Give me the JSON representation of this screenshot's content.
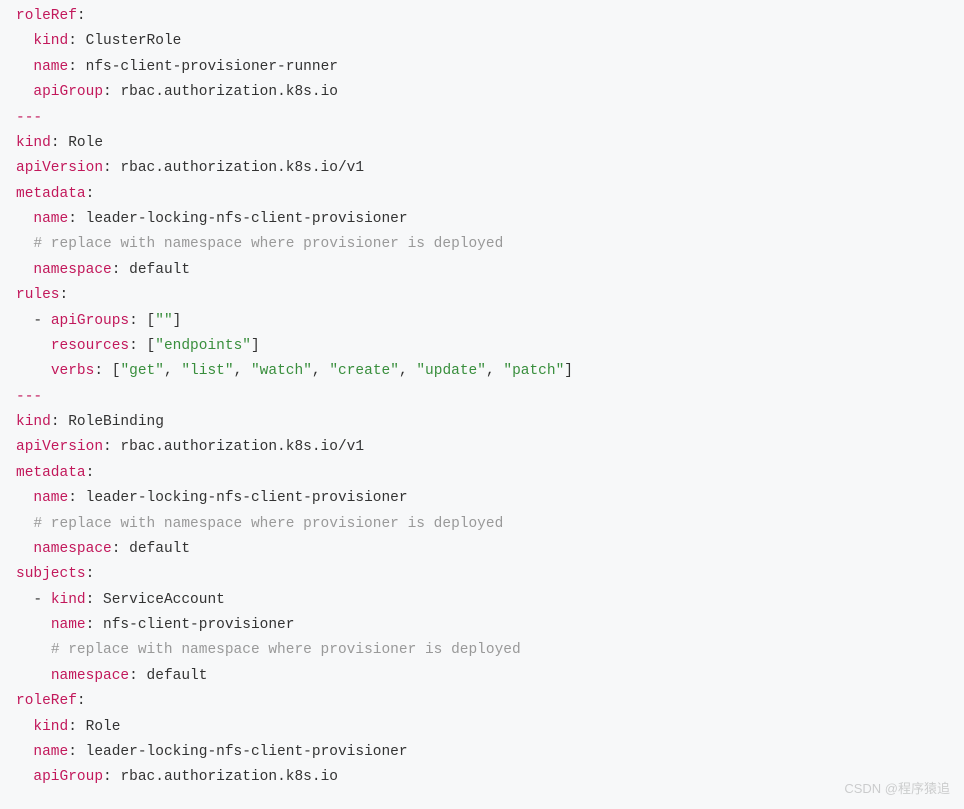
{
  "lines": [
    {
      "i": 0,
      "t": [
        {
          "c": "key",
          "v": "roleRef"
        },
        {
          "c": "punct",
          "v": ":"
        }
      ]
    },
    {
      "i": 2,
      "t": [
        {
          "c": "key",
          "v": "kind"
        },
        {
          "c": "punct",
          "v": ": "
        },
        {
          "c": "value",
          "v": "ClusterRole"
        }
      ]
    },
    {
      "i": 2,
      "t": [
        {
          "c": "key",
          "v": "name"
        },
        {
          "c": "punct",
          "v": ": "
        },
        {
          "c": "value",
          "v": "nfs-client-provisioner-runner"
        }
      ]
    },
    {
      "i": 2,
      "t": [
        {
          "c": "key",
          "v": "apiGroup"
        },
        {
          "c": "punct",
          "v": ": "
        },
        {
          "c": "value",
          "v": "rbac.authorization.k8s.io"
        }
      ]
    },
    {
      "i": 0,
      "t": [
        {
          "c": "key",
          "v": "---"
        }
      ]
    },
    {
      "i": 0,
      "t": [
        {
          "c": "key",
          "v": "kind"
        },
        {
          "c": "punct",
          "v": ": "
        },
        {
          "c": "value",
          "v": "Role"
        }
      ]
    },
    {
      "i": 0,
      "t": [
        {
          "c": "key",
          "v": "apiVersion"
        },
        {
          "c": "punct",
          "v": ": "
        },
        {
          "c": "value",
          "v": "rbac.authorization.k8s.io/v1"
        }
      ]
    },
    {
      "i": 0,
      "t": [
        {
          "c": "key",
          "v": "metadata"
        },
        {
          "c": "punct",
          "v": ":"
        }
      ]
    },
    {
      "i": 2,
      "t": [
        {
          "c": "key",
          "v": "name"
        },
        {
          "c": "punct",
          "v": ": "
        },
        {
          "c": "value",
          "v": "leader-locking-nfs-client-provisioner"
        }
      ]
    },
    {
      "i": 2,
      "t": [
        {
          "c": "comment",
          "v": "# replace with namespace where provisioner is deployed"
        }
      ]
    },
    {
      "i": 2,
      "t": [
        {
          "c": "key",
          "v": "namespace"
        },
        {
          "c": "punct",
          "v": ": "
        },
        {
          "c": "value",
          "v": "default"
        }
      ]
    },
    {
      "i": 0,
      "t": [
        {
          "c": "key",
          "v": "rules"
        },
        {
          "c": "punct",
          "v": ":"
        }
      ]
    },
    {
      "i": 2,
      "t": [
        {
          "c": "dash",
          "v": "- "
        },
        {
          "c": "key",
          "v": "apiGroups"
        },
        {
          "c": "punct",
          "v": ": ["
        },
        {
          "c": "string",
          "v": "\"\""
        },
        {
          "c": "punct",
          "v": "]"
        }
      ]
    },
    {
      "i": 4,
      "t": [
        {
          "c": "key",
          "v": "resources"
        },
        {
          "c": "punct",
          "v": ": ["
        },
        {
          "c": "string",
          "v": "\"endpoints\""
        },
        {
          "c": "punct",
          "v": "]"
        }
      ]
    },
    {
      "i": 4,
      "t": [
        {
          "c": "key",
          "v": "verbs"
        },
        {
          "c": "punct",
          "v": ": ["
        },
        {
          "c": "string",
          "v": "\"get\""
        },
        {
          "c": "punct",
          "v": ", "
        },
        {
          "c": "string",
          "v": "\"list\""
        },
        {
          "c": "punct",
          "v": ", "
        },
        {
          "c": "string",
          "v": "\"watch\""
        },
        {
          "c": "punct",
          "v": ", "
        },
        {
          "c": "string",
          "v": "\"create\""
        },
        {
          "c": "punct",
          "v": ", "
        },
        {
          "c": "string",
          "v": "\"update\""
        },
        {
          "c": "punct",
          "v": ", "
        },
        {
          "c": "string",
          "v": "\"patch\""
        },
        {
          "c": "punct",
          "v": "]"
        }
      ]
    },
    {
      "i": 0,
      "t": [
        {
          "c": "key",
          "v": "---"
        }
      ]
    },
    {
      "i": 0,
      "t": [
        {
          "c": "key",
          "v": "kind"
        },
        {
          "c": "punct",
          "v": ": "
        },
        {
          "c": "value",
          "v": "RoleBinding"
        }
      ]
    },
    {
      "i": 0,
      "t": [
        {
          "c": "key",
          "v": "apiVersion"
        },
        {
          "c": "punct",
          "v": ": "
        },
        {
          "c": "value",
          "v": "rbac.authorization.k8s.io/v1"
        }
      ]
    },
    {
      "i": 0,
      "t": [
        {
          "c": "key",
          "v": "metadata"
        },
        {
          "c": "punct",
          "v": ":"
        }
      ]
    },
    {
      "i": 2,
      "t": [
        {
          "c": "key",
          "v": "name"
        },
        {
          "c": "punct",
          "v": ": "
        },
        {
          "c": "value",
          "v": "leader-locking-nfs-client-provisioner"
        }
      ]
    },
    {
      "i": 2,
      "t": [
        {
          "c": "comment",
          "v": "# replace with namespace where provisioner is deployed"
        }
      ]
    },
    {
      "i": 2,
      "t": [
        {
          "c": "key",
          "v": "namespace"
        },
        {
          "c": "punct",
          "v": ": "
        },
        {
          "c": "value",
          "v": "default"
        }
      ]
    },
    {
      "i": 0,
      "t": [
        {
          "c": "key",
          "v": "subjects"
        },
        {
          "c": "punct",
          "v": ":"
        }
      ]
    },
    {
      "i": 2,
      "t": [
        {
          "c": "dash",
          "v": "- "
        },
        {
          "c": "key",
          "v": "kind"
        },
        {
          "c": "punct",
          "v": ": "
        },
        {
          "c": "value",
          "v": "ServiceAccount"
        }
      ]
    },
    {
      "i": 4,
      "t": [
        {
          "c": "key",
          "v": "name"
        },
        {
          "c": "punct",
          "v": ": "
        },
        {
          "c": "value",
          "v": "nfs-client-provisioner"
        }
      ]
    },
    {
      "i": 4,
      "t": [
        {
          "c": "comment",
          "v": "# replace with namespace where provisioner is deployed"
        }
      ]
    },
    {
      "i": 4,
      "t": [
        {
          "c": "key",
          "v": "namespace"
        },
        {
          "c": "punct",
          "v": ": "
        },
        {
          "c": "value",
          "v": "default"
        }
      ]
    },
    {
      "i": 0,
      "t": [
        {
          "c": "key",
          "v": "roleRef"
        },
        {
          "c": "punct",
          "v": ":"
        }
      ]
    },
    {
      "i": 2,
      "t": [
        {
          "c": "key",
          "v": "kind"
        },
        {
          "c": "punct",
          "v": ": "
        },
        {
          "c": "value",
          "v": "Role"
        }
      ]
    },
    {
      "i": 2,
      "t": [
        {
          "c": "key",
          "v": "name"
        },
        {
          "c": "punct",
          "v": ": "
        },
        {
          "c": "value",
          "v": "leader-locking-nfs-client-provisioner"
        }
      ]
    },
    {
      "i": 2,
      "t": [
        {
          "c": "key",
          "v": "apiGroup"
        },
        {
          "c": "punct",
          "v": ": "
        },
        {
          "c": "value",
          "v": "rbac.authorization.k8s.io"
        }
      ]
    }
  ],
  "watermark": "CSDN @程序猿追"
}
